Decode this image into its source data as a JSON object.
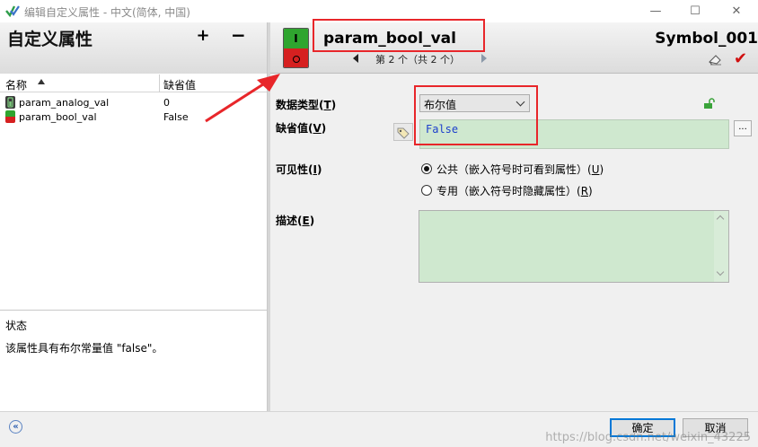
{
  "window": {
    "title": "编辑自定义属性 - 中文(简体, 中国)",
    "buttons": {
      "minimize": "—",
      "maximize": "☐",
      "close": "✕"
    }
  },
  "left_panel": {
    "heading": "自定义属性",
    "add_label": "+",
    "remove_label": "−",
    "table": {
      "headers": {
        "name": "名称",
        "default": "缺省值"
      },
      "rows": [
        {
          "name": "param_analog_val",
          "default": "0",
          "icon": "analog-param-icon"
        },
        {
          "name": "param_bool_val",
          "default": "False",
          "icon": "bool-param-icon"
        }
      ]
    },
    "status": {
      "title": "状态",
      "text": "该属性具有布尔常量值 \"false\"。"
    }
  },
  "right_panel": {
    "param_name": "param_bool_val",
    "navigation": "第 2 个（共 2 个）",
    "symbol_name": "Symbol_001",
    "fields": {
      "data_type_label": "数据类型",
      "data_type_key": "T",
      "data_type_value": "布尔值",
      "default_label": "缺省值",
      "default_key": "V",
      "default_value": "False",
      "ellipsis": "...",
      "visibility_label": "可见性",
      "visibility_key": "I",
      "public_option": "公共（嵌入符号时可看到属性）",
      "public_key": "U",
      "private_option": "专用（嵌入符号时隐藏属性）",
      "private_key": "R",
      "visibility_selected": "public",
      "description_label": "描述",
      "description_key": "E",
      "description_value": ""
    }
  },
  "footer": {
    "collapse_label": "«",
    "ok_label": "确定",
    "cancel_label": "取消"
  },
  "watermark": "https://blog.csdn.net/weixin_43225",
  "colors": {
    "annotation_red": "#e8262a",
    "field_green": "#cfe8cf",
    "switch_green": "#2fa52f",
    "switch_red": "#d62020"
  }
}
